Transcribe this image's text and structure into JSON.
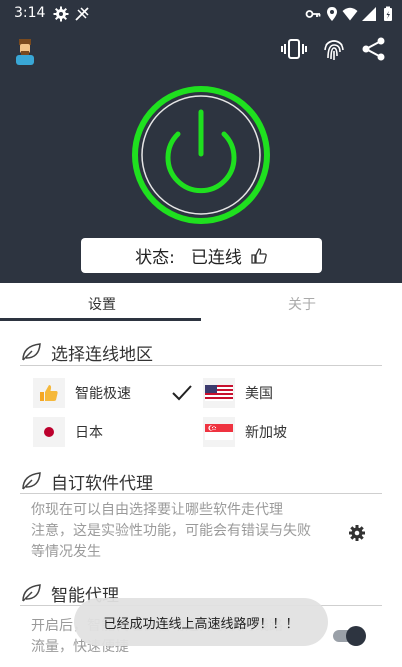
{
  "statusbar": {
    "time": "3:14"
  },
  "status_card": {
    "label": "状态:",
    "value": "已连线"
  },
  "tabs": [
    {
      "label": "设置"
    },
    {
      "label": "关于"
    }
  ],
  "sections": {
    "region": {
      "title": "选择连线地区",
      "items": [
        {
          "label": "智能极速",
          "selected": true
        },
        {
          "label": "美国"
        },
        {
          "label": "日本"
        },
        {
          "label": "新加坡"
        }
      ]
    },
    "custom_proxy": {
      "title": "自订软件代理",
      "desc_lines": [
        "你现在可以自由选择要让哪些软件走代理",
        "注意，这是实验性功能，可能会有错误与失败",
        "等情况发生"
      ]
    },
    "smart_proxy": {
      "title": "智能代理",
      "desc_lines": [
        "开启后，智能代理会自动选择最快的线路",
        "流量，快速便捷"
      ],
      "enabled": true
    }
  },
  "toast": {
    "text": "已经成功连线上高速线路啰！！！"
  },
  "colors": {
    "header_bg": "#2d3440",
    "power_green": "#1fe01f",
    "accent": "#2d3440"
  }
}
